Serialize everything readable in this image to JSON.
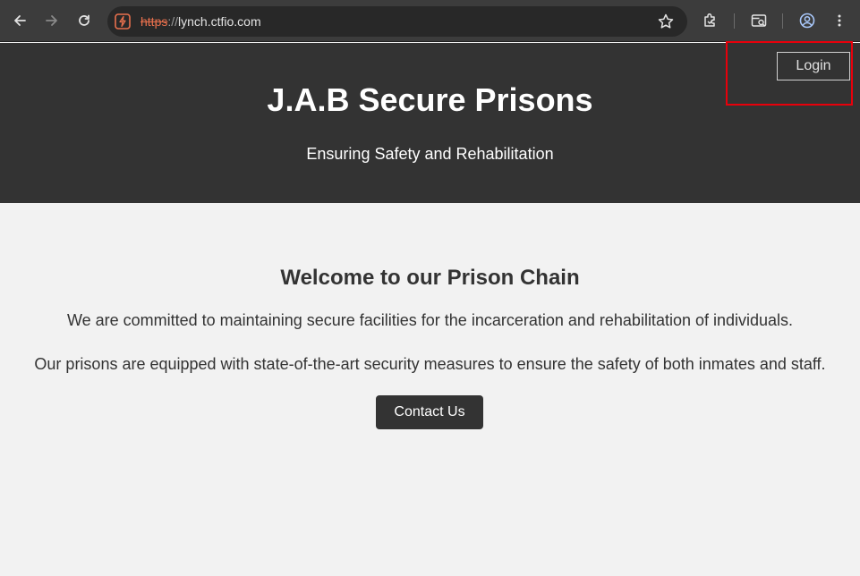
{
  "browser": {
    "url_scheme": "https",
    "url_separator": "://",
    "url_host": "lynch.ctfio.com",
    "icons": {
      "back": "back-arrow-icon",
      "forward": "forward-arrow-icon",
      "reload": "reload-icon",
      "site_info": "site-info-icon",
      "bookmark": "star-icon",
      "extensions": "puzzle-icon",
      "search_tab": "tab-search-icon",
      "profile": "profile-icon",
      "menu": "kebab-menu-icon"
    }
  },
  "header": {
    "title": "J.A.B Secure Prisons",
    "subtitle": "Ensuring Safety and Rehabilitation",
    "login_label": "Login"
  },
  "main": {
    "welcome_title": "Welcome to our Prison Chain",
    "paragraph_1": "We are committed to maintaining secure facilities for the incarceration and rehabilitation of individuals.",
    "paragraph_2": "Our prisons are equipped with state-of-the-art security measures to ensure the safety of both inmates and staff.",
    "contact_label": "Contact Us"
  },
  "colors": {
    "header_bg": "#333333",
    "page_bg": "#f2f2f2",
    "highlight": "#e8000b",
    "insecure_scheme": "#e8704d"
  }
}
